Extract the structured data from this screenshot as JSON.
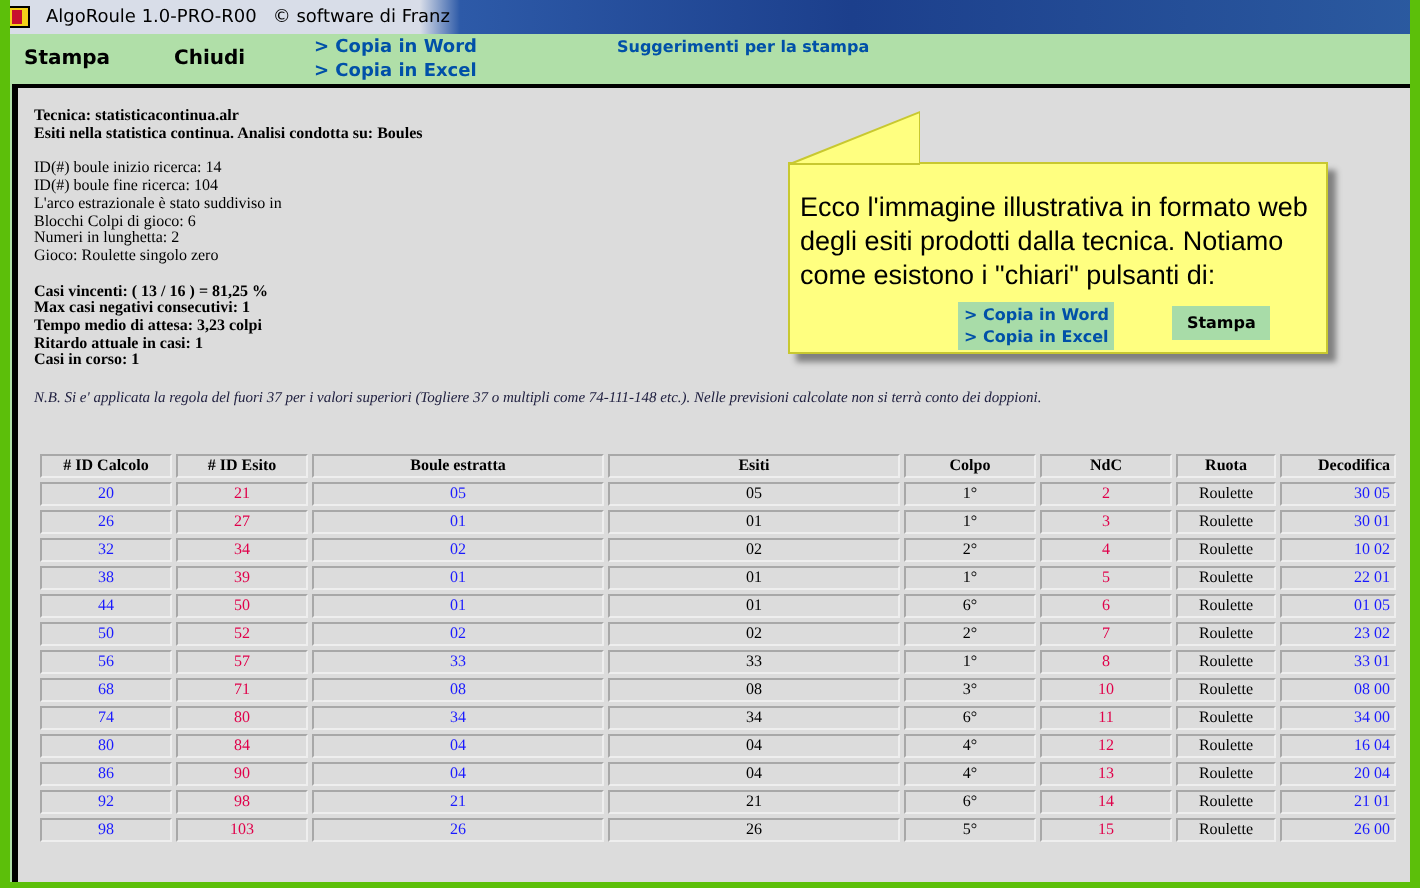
{
  "window": {
    "title": "AlgoRoule 1.0-PRO-R00",
    "credit": "© software di Franz"
  },
  "toolbar": {
    "buttons": [
      "Stampa",
      "Chiudi"
    ],
    "links": [
      "> Copia in Word",
      "> Copia in Excel"
    ],
    "hint": "Suggerimenti per la stampa"
  },
  "report": {
    "heading": [
      "Tecnica: statisticacontinua.alr",
      "Esiti nella statistica continua. Analisi condotta su: Boules"
    ],
    "parameters": [
      "ID(#) boule inizio ricerca: 14",
      "ID(#) boule fine ricerca: 104",
      "L'arco estrazionale è stato suddiviso in",
      "Blocchi Colpi di gioco: 6",
      "Numeri in lunghetta: 2",
      "Gioco: Roulette singolo zero"
    ],
    "statistics": [
      "Casi vincenti: ( 13 / 16 ) = 81,25 %",
      "Max casi negativi consecutivi: 1",
      "Tempo medio di attesa: 3,23 colpi",
      "Ritardo attuale in casi: 1",
      "Casi in corso: 1"
    ],
    "note": "N.B. Si e' applicata la regola del fuori 37 per i valori superiori (Togliere 37 o multipli come 74-111-148 etc.). Nelle previsioni calcolate non si terrà conto dei doppioni."
  },
  "table": {
    "columns": [
      {
        "label": "# ID Calcolo",
        "color": "#1a1aff"
      },
      {
        "label": "# ID Esito",
        "color": "#e0004a"
      },
      {
        "label": "Boule estratta",
        "color": "#1a1aff"
      },
      {
        "label": "Esiti"
      },
      {
        "label": "Colpo"
      },
      {
        "label": "NdC",
        "color": "#e0004a"
      },
      {
        "label": "Ruota"
      },
      {
        "label": "Decodifica",
        "color": "#1a1aff"
      }
    ],
    "rows": [
      [
        "20",
        "21",
        "05",
        "05",
        "1°",
        "2",
        "Roulette",
        "30 05"
      ],
      [
        "26",
        "27",
        "01",
        "01",
        "1°",
        "3",
        "Roulette",
        "30 01"
      ],
      [
        "32",
        "34",
        "02",
        "02",
        "2°",
        "4",
        "Roulette",
        "10 02"
      ],
      [
        "38",
        "39",
        "01",
        "01",
        "1°",
        "5",
        "Roulette",
        "22 01"
      ],
      [
        "44",
        "50",
        "01",
        "01",
        "6°",
        "6",
        "Roulette",
        "01 05"
      ],
      [
        "50",
        "52",
        "02",
        "02",
        "2°",
        "7",
        "Roulette",
        "23 02"
      ],
      [
        "56",
        "57",
        "33",
        "33",
        "1°",
        "8",
        "Roulette",
        "33 01"
      ],
      [
        "68",
        "71",
        "08",
        "08",
        "3°",
        "10",
        "Roulette",
        "08 00"
      ],
      [
        "74",
        "80",
        "34",
        "34",
        "6°",
        "11",
        "Roulette",
        "34 00"
      ],
      [
        "80",
        "84",
        "04",
        "04",
        "4°",
        "12",
        "Roulette",
        "16 04"
      ],
      [
        "86",
        "90",
        "04",
        "04",
        "4°",
        "13",
        "Roulette",
        "20 04"
      ],
      [
        "92",
        "98",
        "21",
        "21",
        "6°",
        "14",
        "Roulette",
        "21 01"
      ],
      [
        "98",
        "103",
        "26",
        "26",
        "5°",
        "15",
        "Roulette",
        "26 00"
      ]
    ]
  },
  "callout": {
    "text": "Ecco l'immagine illustrativa in formato web degli esiti prodotti dalla tecnica. Notiamo come esistono i \"chiari\" pulsanti di:",
    "links": [
      "> Copia in Word",
      "> Copia in Excel"
    ],
    "button": "Stampa"
  }
}
